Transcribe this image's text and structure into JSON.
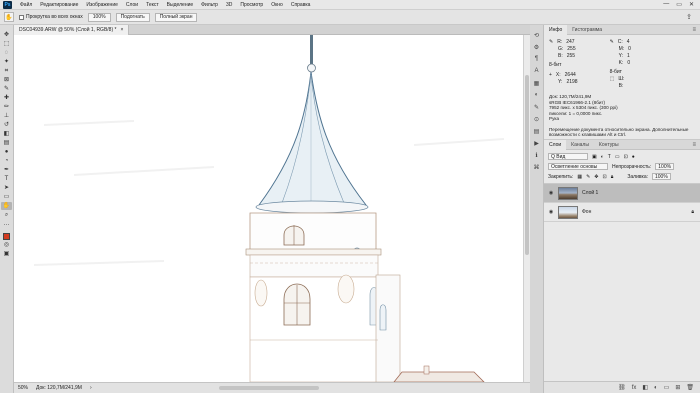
{
  "app": {
    "logo": "Ps"
  },
  "menu": [
    "Файл",
    "Редактирование",
    "Изображение",
    "Слои",
    "Текст",
    "Выделение",
    "Фильтр",
    "3D",
    "Просмотр",
    "Окно",
    "Справка"
  ],
  "window_controls": {
    "minimize": "—",
    "maximize": "▭",
    "close": "✕"
  },
  "options": {
    "tool_icon": "hand-icon",
    "scroll_all_label": "Прокрутка во всех окнах",
    "zoom_button": "100%",
    "fit_button": "Подогнать",
    "fill_button": "Полный экран"
  },
  "tools": [
    "move-icon",
    "marquee-icon",
    "lasso-icon",
    "magic-wand-icon",
    "crop-icon",
    "frame-icon",
    "eyedropper-icon",
    "healing-icon",
    "brush-icon",
    "stamp-icon",
    "history-brush-icon",
    "eraser-icon",
    "gradient-icon",
    "blur-icon",
    "dodge-icon",
    "pen-icon",
    "type-icon",
    "path-select-icon",
    "shape-icon",
    "hand-icon",
    "zoom-icon",
    "extra-icon"
  ],
  "colors": {
    "foreground": "#d33a1f",
    "background": "#ffffff"
  },
  "document": {
    "tab_title": "DSC04939.ARW @ 50% (Слой 1, RGB/8) *",
    "zoom": "50%",
    "status": "Док: 120,7М/241,9М"
  },
  "info_panel": {
    "tabs": [
      "Инфо",
      "Гистограмма"
    ],
    "rgb_labels": [
      "R:",
      "G:",
      "B:"
    ],
    "rgb_values": [
      "247",
      "255",
      "255"
    ],
    "bit_depth": "8-бит",
    "xy_labels": [
      "X:",
      "Y:"
    ],
    "xy_values": [
      "2644",
      "2198"
    ],
    "cmyk_labels": [
      "C:",
      "M:",
      "Y:",
      "K:"
    ],
    "cmyk_values": [
      "4",
      "0",
      "1",
      "0"
    ],
    "bit_depth2": "8-бит",
    "wh_labels": [
      "Ш:",
      "В:"
    ],
    "wh_values": [
      "",
      ""
    ],
    "doc_lines": [
      "Док: 120,7М/241,9М",
      "sRGB IEC61966-2.1 (8бит)",
      "7952 пикс. x 5304 пикс. (300 ppi)",
      "пиксели: 1 = 0,0000 пикс.",
      "Рука"
    ],
    "hint": "Перемещение документа относительно экрана. Дополнительные возможности с клавишами Alt и Ctrl."
  },
  "layers_panel": {
    "tabs": [
      "Слои",
      "Каналы",
      "Контуры"
    ],
    "filter_label": "Q Вид",
    "blend_mode": "Осветление основы",
    "opacity_label": "Непрозрачность:",
    "opacity_value": "100%",
    "lock_label": "Закрепить:",
    "fill_label": "Заливка:",
    "fill_value": "100%",
    "layers": [
      {
        "name": "Слой 1",
        "selected": true
      },
      {
        "name": "Фон",
        "selected": false
      }
    ],
    "bottom_icons": [
      "link-icon",
      "fx-icon",
      "mask-icon",
      "adjustment-icon",
      "group-icon",
      "new-layer-icon",
      "trash-icon"
    ]
  }
}
